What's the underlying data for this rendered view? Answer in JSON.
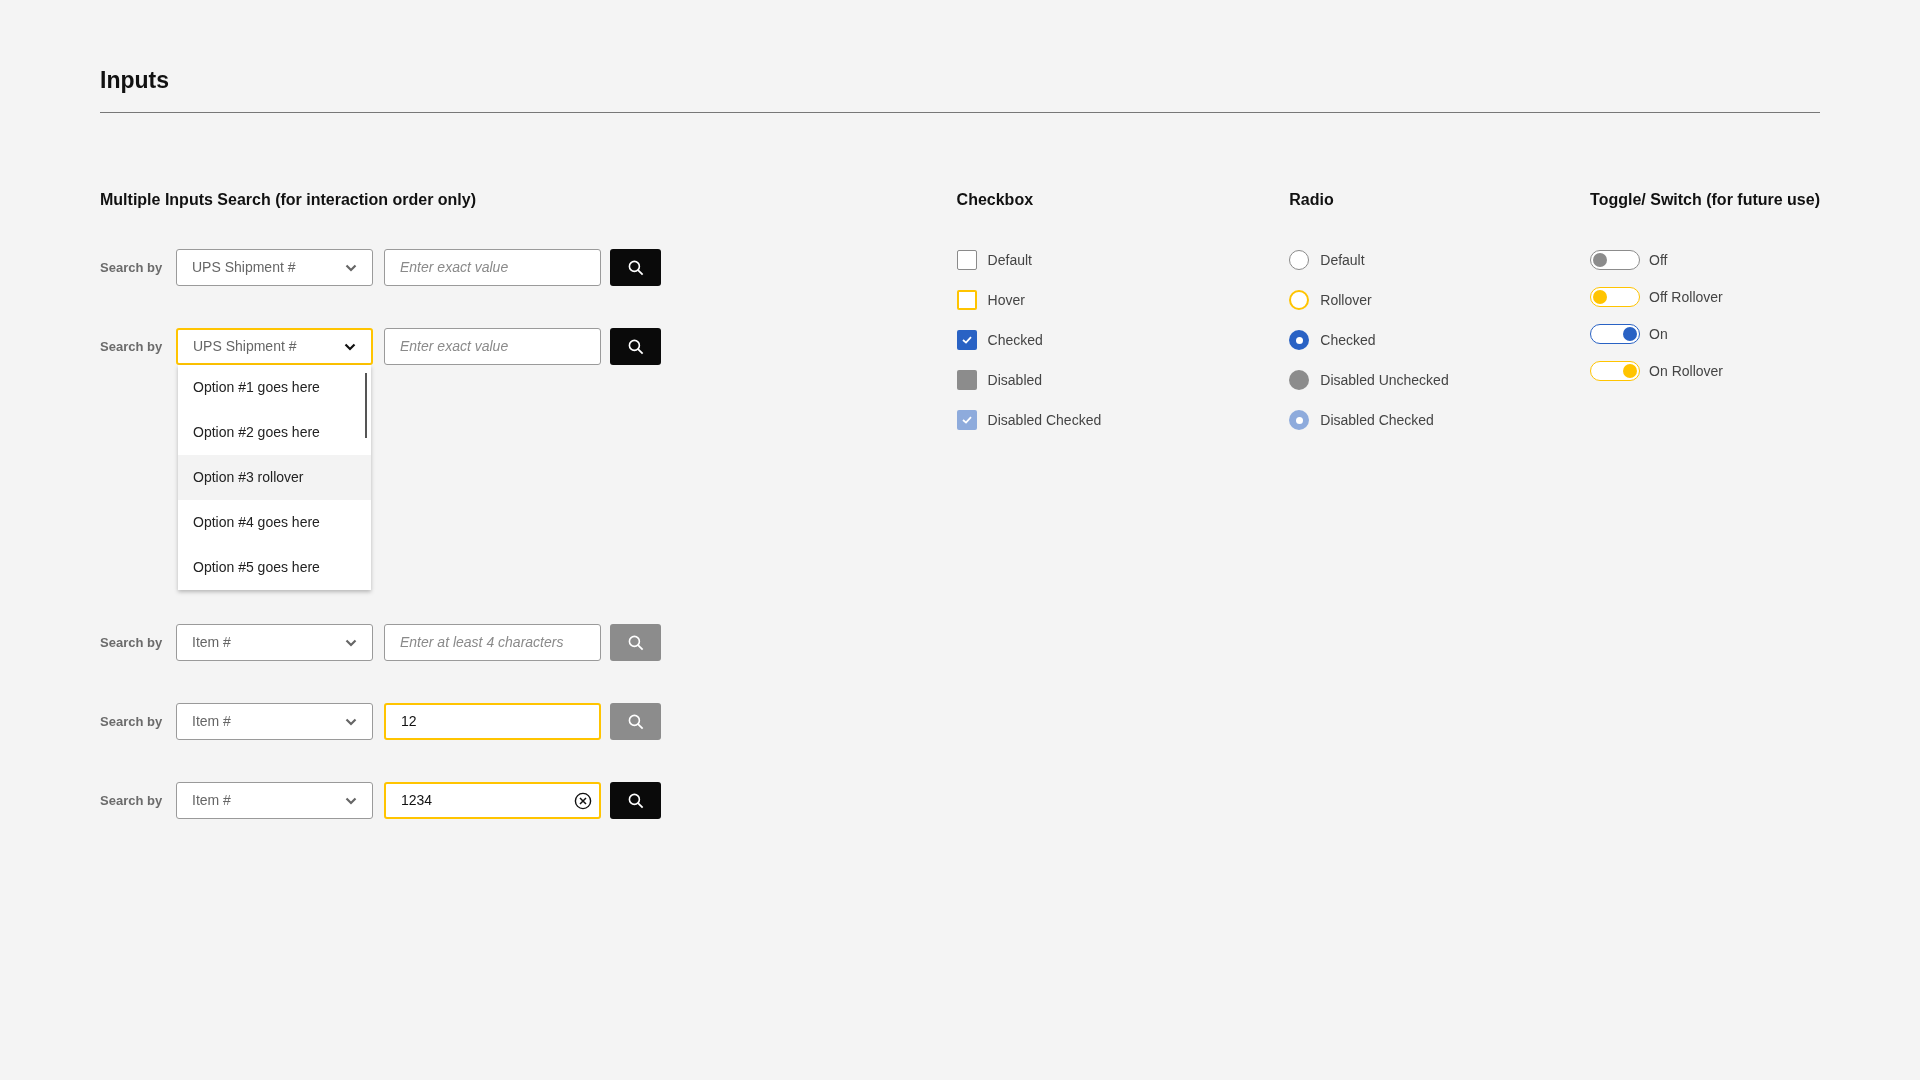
{
  "page_title": "Inputs",
  "search_section": {
    "heading": "Multiple Inputs Search (for interaction order only)",
    "rows": [
      {
        "label": "Search by",
        "select": {
          "value": "UPS Shipment #",
          "focused": false
        },
        "input": {
          "placeholder": "Enter exact value",
          "focused": false,
          "clearable": false
        },
        "button": {
          "disabled": false
        }
      },
      {
        "label": "Search by",
        "select": {
          "value": "UPS Shipment #",
          "focused": true
        },
        "input": {
          "placeholder": "Enter exact value",
          "focused": false,
          "clearable": false
        },
        "button": {
          "disabled": false
        },
        "dropdown": [
          {
            "label": "Option #1 goes here",
            "hovered": false
          },
          {
            "label": "Option #2 goes here",
            "hovered": false
          },
          {
            "label": "Option #3 rollover",
            "hovered": true
          },
          {
            "label": "Option #4 goes here",
            "hovered": false
          },
          {
            "label": "Option #5 goes here",
            "hovered": false
          }
        ]
      },
      {
        "label": "Search by",
        "select": {
          "value": "Item #",
          "focused": false
        },
        "input": {
          "placeholder": "Enter at least 4 characters",
          "focused": false,
          "clearable": false
        },
        "button": {
          "disabled": true
        }
      },
      {
        "label": "Search by",
        "select": {
          "value": "Item #",
          "focused": false
        },
        "input": {
          "value": "12",
          "focused": true,
          "clearable": false
        },
        "button": {
          "disabled": true
        }
      },
      {
        "label": "Search by",
        "select": {
          "value": "Item #",
          "focused": false
        },
        "input": {
          "value": "1234",
          "focused": true,
          "clearable": true
        },
        "button": {
          "disabled": false
        }
      }
    ]
  },
  "checkbox_section": {
    "heading": "Checkbox",
    "items": [
      {
        "label": "Default",
        "checked": false,
        "hovered": false,
        "disabled": false
      },
      {
        "label": "Hover",
        "checked": false,
        "hovered": true,
        "disabled": false
      },
      {
        "label": "Checked",
        "checked": true,
        "hovered": false,
        "disabled": false
      },
      {
        "label": "Disabled",
        "checked": false,
        "hovered": false,
        "disabled": true
      },
      {
        "label": "Disabled Checked",
        "checked": true,
        "hovered": false,
        "disabled": true
      }
    ]
  },
  "radio_section": {
    "heading": "Radio",
    "items": [
      {
        "label": "Default",
        "checked": false,
        "hovered": false,
        "disabled": false
      },
      {
        "label": "Rollover",
        "checked": false,
        "hovered": true,
        "disabled": false
      },
      {
        "label": "Checked",
        "checked": true,
        "hovered": false,
        "disabled": false
      },
      {
        "label": "Disabled Unchecked",
        "checked": false,
        "hovered": false,
        "disabled": true
      },
      {
        "label": "Disabled Checked",
        "checked": true,
        "hovered": false,
        "disabled": true
      }
    ]
  },
  "toggle_section": {
    "heading": "Toggle/ Switch (for future use)",
    "items": [
      {
        "label": "Off",
        "on": false,
        "hovered": false
      },
      {
        "label": "Off Rollover",
        "on": false,
        "hovered": true
      },
      {
        "label": "On",
        "on": true,
        "hovered": false
      },
      {
        "label": "On Rollover",
        "on": true,
        "hovered": true
      }
    ]
  }
}
